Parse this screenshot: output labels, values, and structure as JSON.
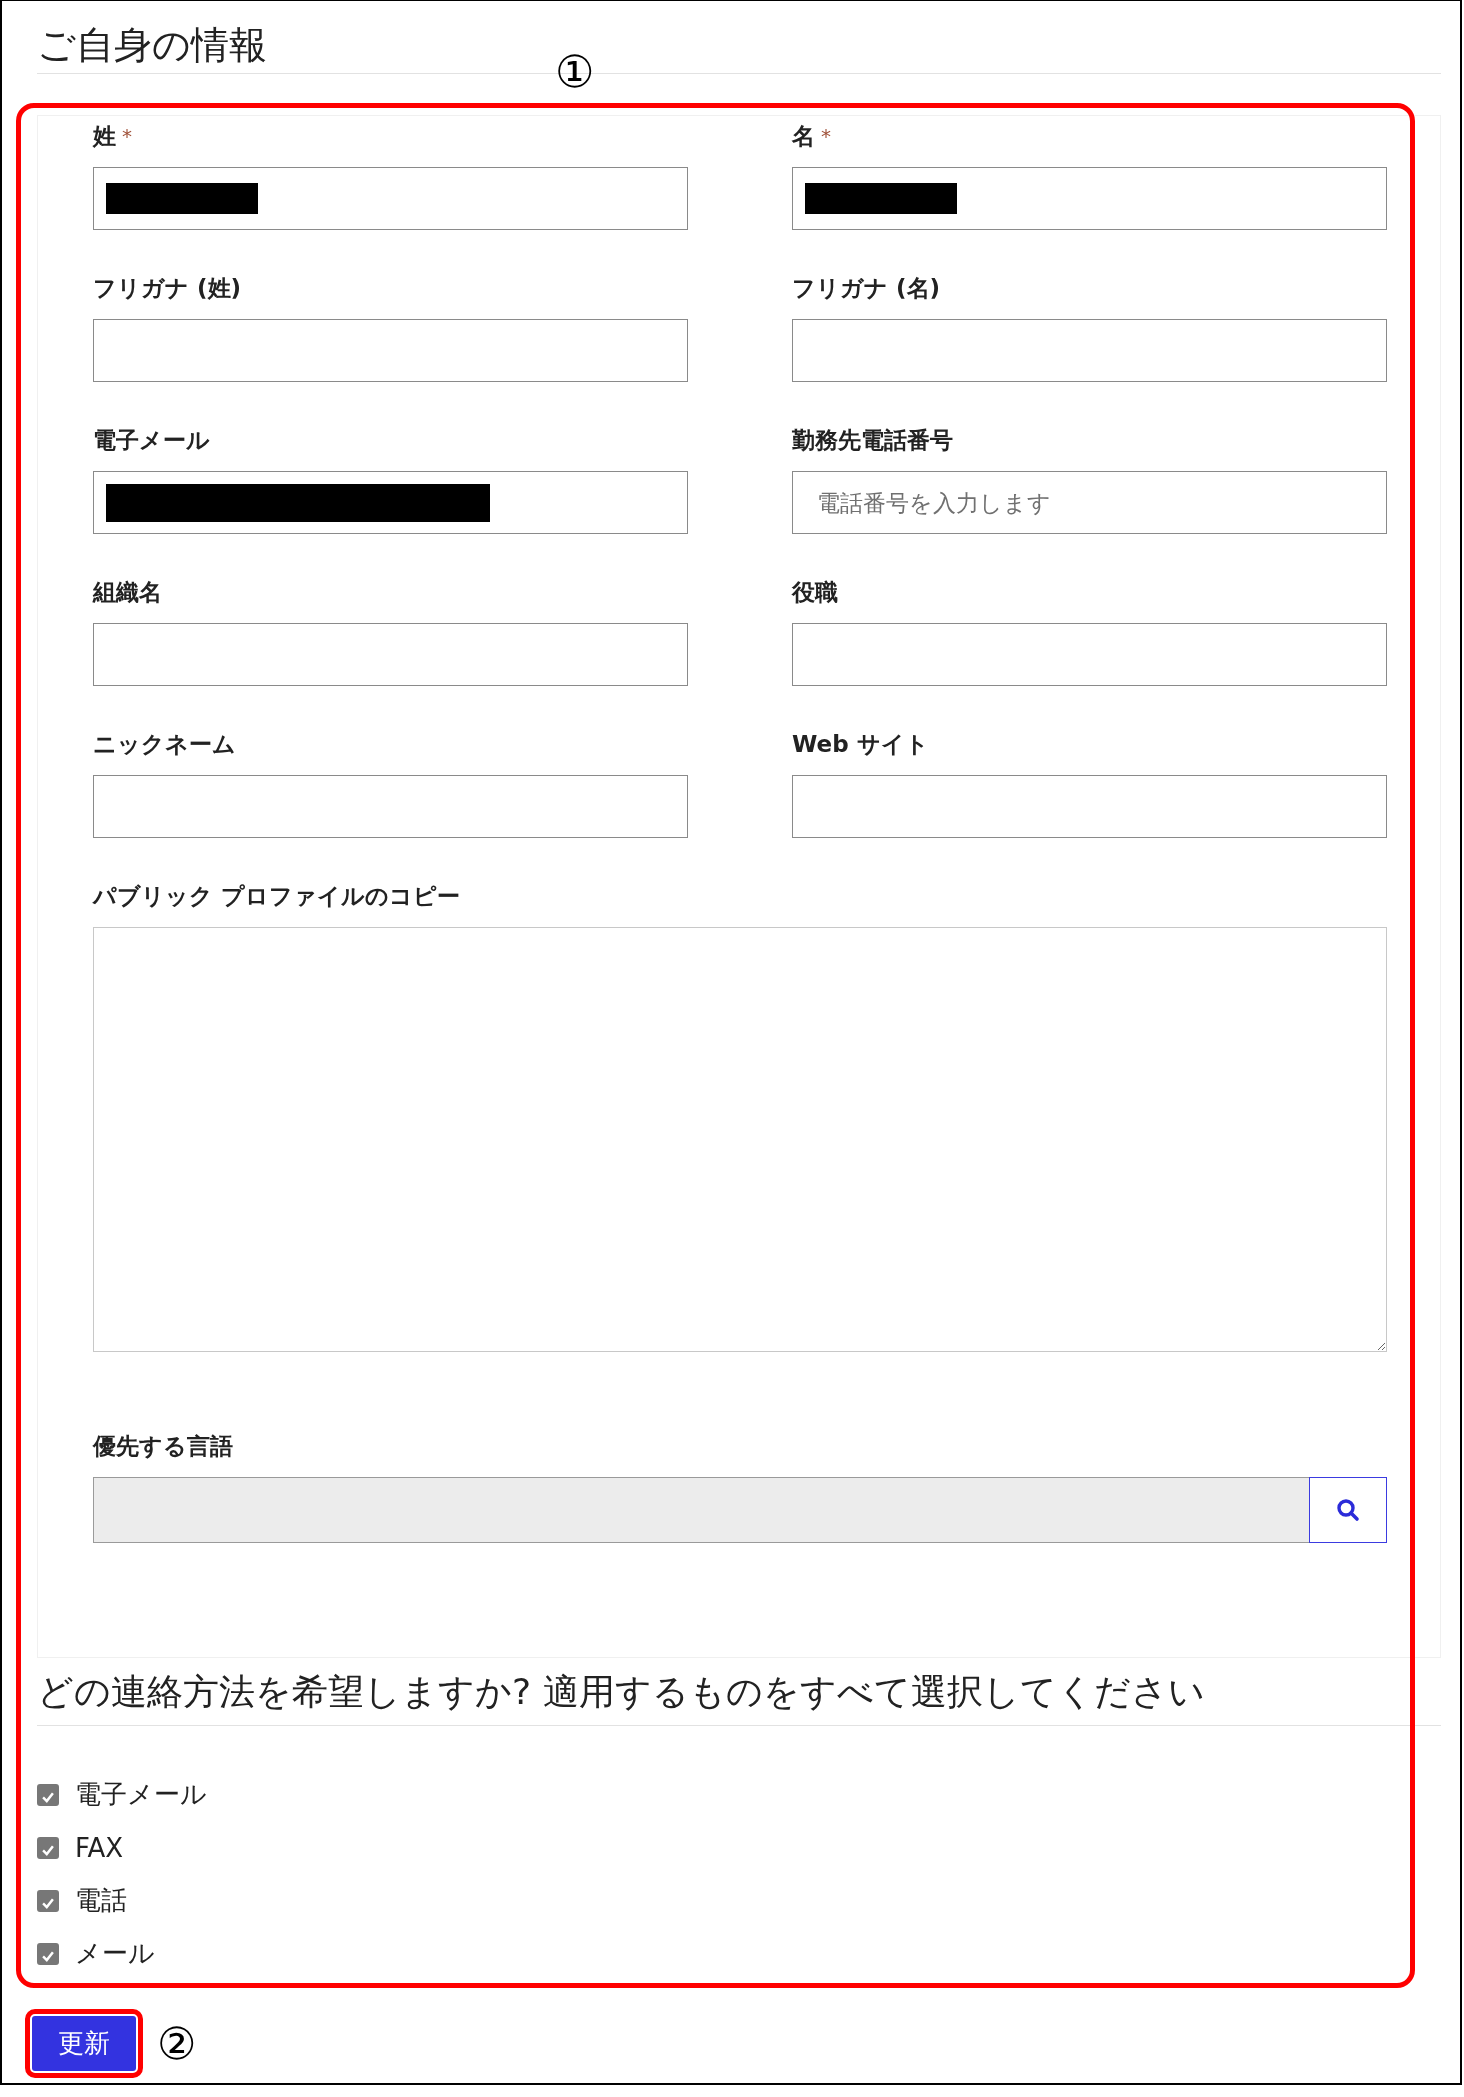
{
  "profile": {
    "title": "ご自身の情報",
    "required_mark": "*",
    "fields": [
      {
        "label": "姓",
        "required": true,
        "kind": "text",
        "redacted": true
      },
      {
        "label": "名",
        "required": true,
        "kind": "text",
        "redacted": true
      },
      {
        "label": "フリガナ (姓)",
        "required": false,
        "kind": "text"
      },
      {
        "label": "フリガナ (名)",
        "required": false,
        "kind": "text"
      },
      {
        "label": "電子メール",
        "required": false,
        "kind": "text",
        "redacted": true
      },
      {
        "label": "勤務先電話番号",
        "required": false,
        "kind": "text",
        "placeholder": "電話番号を入力します"
      },
      {
        "label": "組織名",
        "required": false,
        "kind": "text"
      },
      {
        "label": "役職",
        "required": false,
        "kind": "text"
      },
      {
        "label": "ニックネーム",
        "required": false,
        "kind": "text"
      },
      {
        "label": "Web サイト",
        "required": false,
        "kind": "text"
      },
      {
        "label": "パブリック プロファイルのコピー",
        "required": false,
        "kind": "textarea"
      },
      {
        "label": "優先する言語",
        "required": false,
        "kind": "lookup",
        "disabled": true
      }
    ]
  },
  "contact": {
    "title": "どの連絡方法を希望しますか? 適用するものをすべて選択してください",
    "options": [
      {
        "label": "電子メール",
        "checked": true
      },
      {
        "label": "FAX",
        "checked": true
      },
      {
        "label": "電話",
        "checked": true
      },
      {
        "label": "メール",
        "checked": true
      }
    ]
  },
  "submit": {
    "label": "更新"
  },
  "annotations": [
    "①",
    "②"
  ]
}
